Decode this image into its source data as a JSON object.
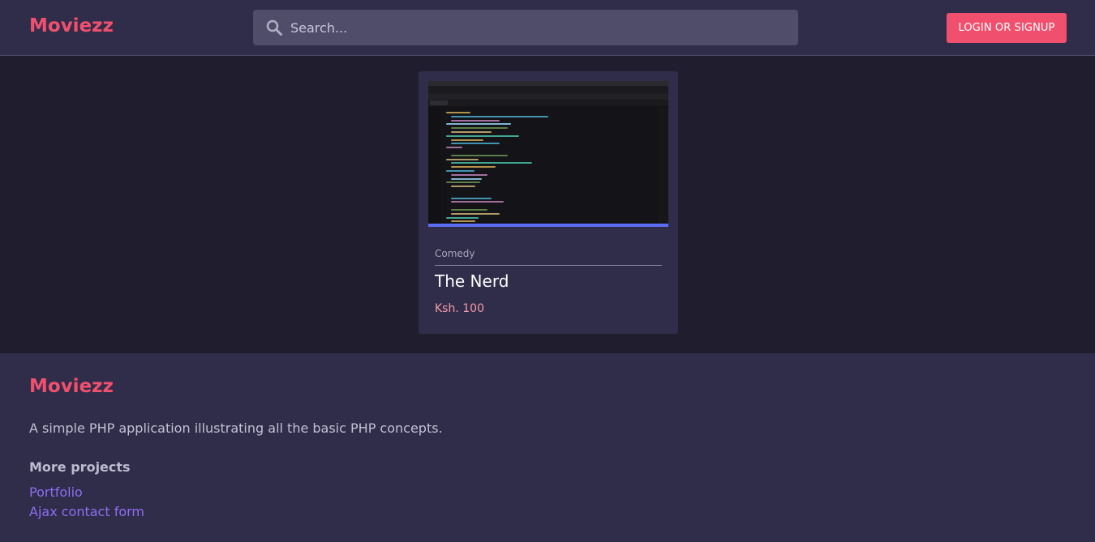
{
  "header": {
    "brand": "Moviezz",
    "search_placeholder": "Search...",
    "login_label": "LOGIN OR SIGNUP"
  },
  "movie": {
    "genre": "Comedy",
    "title": "The Nerd",
    "price": "Ksh. 100",
    "thumbnail_icon": "code-editor-screenshot"
  },
  "footer": {
    "brand": "Moviezz",
    "description": "A simple PHP application illustrating all the basic PHP concepts.",
    "projects_heading": "More projects",
    "links": [
      "Portfolio",
      "Ajax contact form"
    ]
  },
  "colors": {
    "accent": "#f0506e",
    "header_bg": "#302d4a",
    "page_bg": "#1f1d2e",
    "link": "#8f6df3",
    "price": "#f59aa8"
  }
}
